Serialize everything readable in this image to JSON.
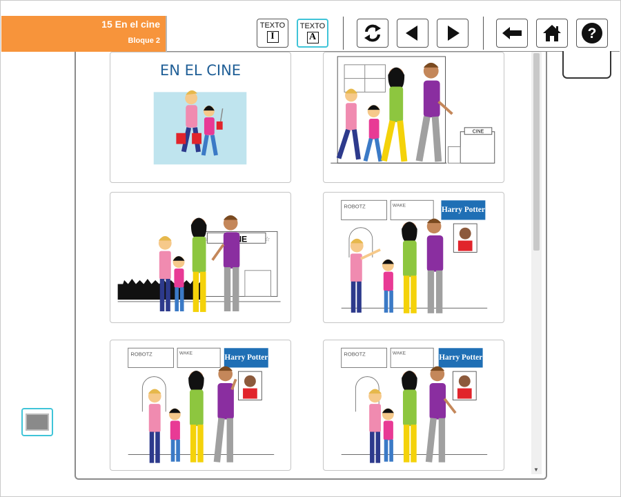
{
  "header": {
    "title": "15 En el cine",
    "subtitle": "Bloque 2"
  },
  "toolbar": {
    "text_button_1": {
      "label": "TEXTO",
      "glyph": "I",
      "active": false
    },
    "text_button_2": {
      "label": "TEXTO",
      "glyph": "A",
      "active": true
    },
    "icons": [
      "refresh-icon",
      "prev-icon",
      "next-icon",
      "back-arrow-icon",
      "home-icon",
      "help-icon"
    ]
  },
  "cards": [
    {
      "title": "EN EL CINE"
    },
    {
      "sign": "CINE"
    },
    {
      "sign": "CINE"
    },
    {
      "posters": [
        "ROBOTZ",
        "WAKE",
        "Harry Potter"
      ]
    },
    {
      "posters": [
        "ROBOTZ",
        "WAKE",
        "Harry Potter"
      ]
    },
    {
      "posters": [
        "ROBOTZ",
        "WAKE",
        "Harry Potter"
      ]
    }
  ],
  "colors": {
    "accent": "#f7943b",
    "active_border": "#3fc4d8",
    "title_blue": "#1f5e96"
  }
}
